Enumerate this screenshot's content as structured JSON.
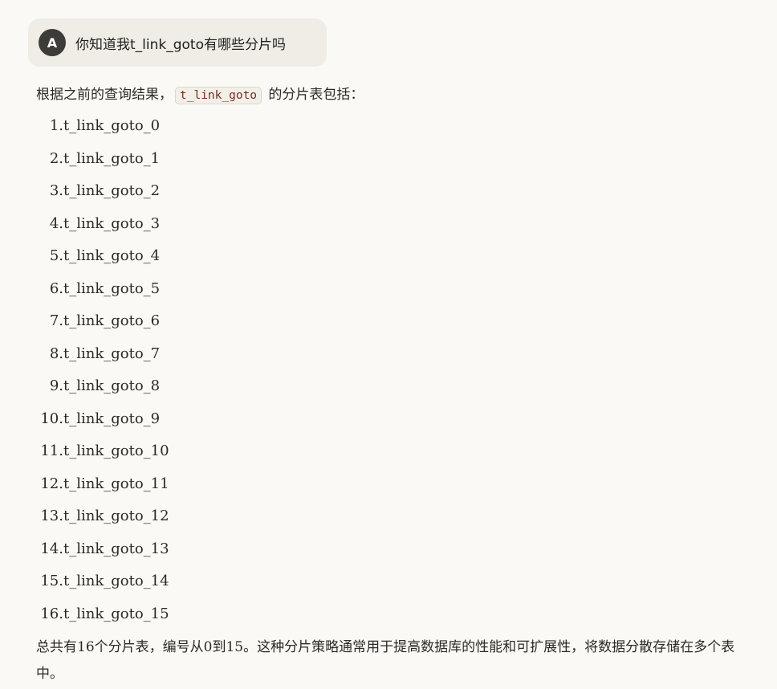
{
  "user_message": {
    "avatar_initial": "A",
    "text": "你知道我t_link_goto有哪些分片吗"
  },
  "reply": {
    "intro_before": "根据之前的查询结果，",
    "intro_code": "t_link_goto",
    "intro_after": " 的分片表包括：",
    "items": [
      {
        "num": "1.",
        "text": "t_link_goto_0"
      },
      {
        "num": "2.",
        "text": "t_link_goto_1"
      },
      {
        "num": "3.",
        "text": "t_link_goto_2"
      },
      {
        "num": "4.",
        "text": "t_link_goto_3"
      },
      {
        "num": "5.",
        "text": "t_link_goto_4"
      },
      {
        "num": "6.",
        "text": "t_link_goto_5"
      },
      {
        "num": "7.",
        "text": "t_link_goto_6"
      },
      {
        "num": "8.",
        "text": "t_link_goto_7"
      },
      {
        "num": "9.",
        "text": "t_link_goto_8"
      },
      {
        "num": "10.",
        "text": "t_link_goto_9"
      },
      {
        "num": "11.",
        "text": "t_link_goto_10"
      },
      {
        "num": "12.",
        "text": "t_link_goto_11"
      },
      {
        "num": "13.",
        "text": "t_link_goto_12"
      },
      {
        "num": "14.",
        "text": "t_link_goto_13"
      },
      {
        "num": "15.",
        "text": "t_link_goto_14"
      },
      {
        "num": "16.",
        "text": "t_link_goto_15"
      }
    ],
    "summary": "总共有16个分片表，编号从0到15。这种分片策略通常用于提高数据库的性能和可扩展性，将数据分散存储在多个表中。"
  }
}
